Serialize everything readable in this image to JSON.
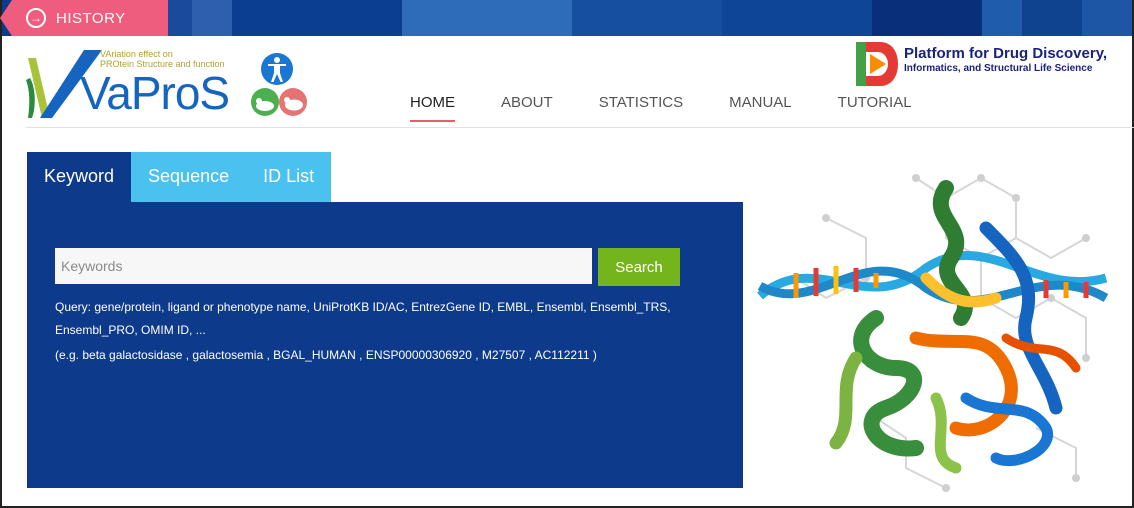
{
  "history": {
    "icon": "circle-arrow-right-icon",
    "label": "HISTORY",
    "color": "#ee5d7d"
  },
  "logo": {
    "line1": "VAriation effect on",
    "line2": "PROtein Structure and function",
    "name": "VaProS"
  },
  "nav": {
    "items": [
      {
        "label": "HOME",
        "active": true
      },
      {
        "label": "ABOUT",
        "active": false
      },
      {
        "label": "STATISTICS",
        "active": false
      },
      {
        "label": "MANUAL",
        "active": false
      },
      {
        "label": "TUTORIAL",
        "active": false
      }
    ]
  },
  "partner": {
    "title": "Platform for Drug Discovery,",
    "subtitle": "Informatics, and Structural Life Science"
  },
  "tabs": [
    {
      "label": "Keyword",
      "active": true
    },
    {
      "label": "Sequence",
      "active": false
    },
    {
      "label": "ID List",
      "active": false
    }
  ],
  "search": {
    "placeholder": "Keywords",
    "value": "",
    "button_label": "Search",
    "hint_line1": "Query: gene/protein, ligand or phenotype name, UniProtKB ID/AC, EntrezGene ID, EMBL, Ensembl, Ensembl_TRS,",
    "hint_line2": "Ensembl_PRO, OMIM ID, ...",
    "hint_line3": "(e.g.  beta galactosidase ,  galactosemia ,  BGAL_HUMAN ,  ENSP00000306920 ,  M27507 ,  AC112211 )"
  },
  "colors": {
    "panel": "#0d3a8a",
    "tab_inactive": "#4bc1f0",
    "search_button": "#74b51d",
    "logo_blue": "#1565c0"
  }
}
